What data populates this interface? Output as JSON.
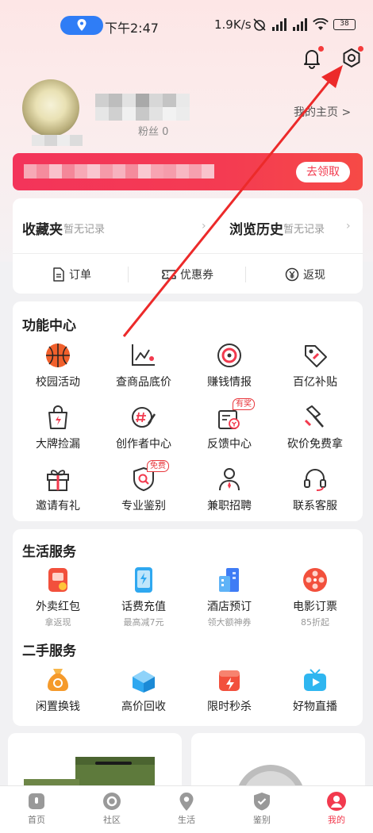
{
  "status_bar": {
    "time": "下午2:47",
    "net_speed": "1.9K/s",
    "battery": "38"
  },
  "profile": {
    "fans_label": "粉丝 0",
    "my_home_label": "我的主页 >"
  },
  "promo": {
    "button_label": "去领取"
  },
  "favorites": {
    "collection_title": "收藏夹",
    "collection_sub": "暂无记录",
    "history_title": "浏览历史",
    "history_sub": "暂无记录"
  },
  "quick_links": [
    {
      "label": "订单",
      "icon": "document-icon"
    },
    {
      "label": "优惠券",
      "icon": "ticket-icon"
    },
    {
      "label": "返现",
      "icon": "yen-circle-icon"
    }
  ],
  "function_center": {
    "title": "功能中心",
    "items": [
      {
        "label": "校园活动",
        "icon": "basketball-icon"
      },
      {
        "label": "查商品底价",
        "icon": "price-chart-icon"
      },
      {
        "label": "赚钱情报",
        "icon": "target-icon"
      },
      {
        "label": "百亿补贴",
        "icon": "price-tag-icon"
      },
      {
        "label": "大牌捡漏",
        "icon": "shopping-bag-icon"
      },
      {
        "label": "创作者中心",
        "icon": "creator-pen-icon"
      },
      {
        "label": "反馈中心",
        "icon": "feedback-icon",
        "badge": "有奖"
      },
      {
        "label": "砍价免费拿",
        "icon": "axe-icon"
      },
      {
        "label": "邀请有礼",
        "icon": "gift-icon"
      },
      {
        "label": "专业鉴别",
        "icon": "shield-search-icon",
        "badge": "免费"
      },
      {
        "label": "兼职招聘",
        "icon": "person-icon"
      },
      {
        "label": "联系客服",
        "icon": "headset-icon"
      }
    ]
  },
  "life_services": {
    "title": "生活服务",
    "items": [
      {
        "label": "外卖红包",
        "sub": "拿返现",
        "icon": "takeout-icon",
        "color": "#f2503c"
      },
      {
        "label": "话费充值",
        "sub": "最高减7元",
        "icon": "phone-recharge-icon",
        "color": "#2fa8f0"
      },
      {
        "label": "酒店预订",
        "sub": "领大额神券",
        "icon": "hotel-icon",
        "color": "#3f7cf5"
      },
      {
        "label": "电影订票",
        "sub": "85折起",
        "icon": "film-reel-icon",
        "color": "#f2503c"
      }
    ]
  },
  "second_hand": {
    "title": "二手服务",
    "items": [
      {
        "label": "闲置换钱",
        "icon": "money-bag-icon",
        "color": "#f59a2b"
      },
      {
        "label": "高价回收",
        "icon": "recycle-box-icon",
        "color": "#2fa8f0"
      },
      {
        "label": "限时秒杀",
        "icon": "flash-sale-icon",
        "color": "#f2503c"
      },
      {
        "label": "好物直播",
        "icon": "live-tv-icon",
        "color": "#2fb6f0"
      }
    ]
  },
  "tabbar": [
    {
      "label": "首页",
      "icon": "home-icon"
    },
    {
      "label": "社区",
      "icon": "community-icon"
    },
    {
      "label": "生活",
      "icon": "location-pin-icon"
    },
    {
      "label": "鉴别",
      "icon": "shield-check-icon"
    },
    {
      "label": "我的",
      "icon": "profile-icon"
    }
  ],
  "colors": {
    "accent": "#f23a4e",
    "background": "#f1f1f3"
  }
}
